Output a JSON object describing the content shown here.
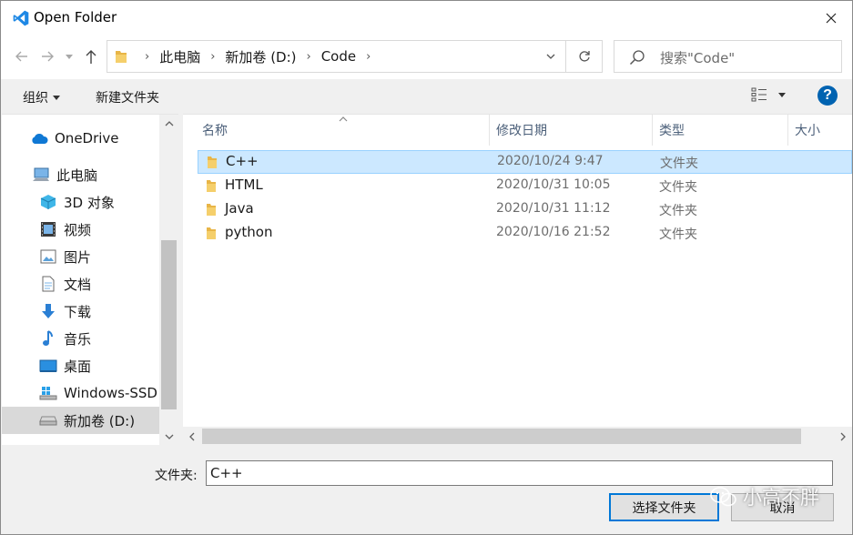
{
  "window": {
    "title": "Open Folder"
  },
  "nav": {
    "breadcrumbs": [
      "此电脑",
      "新加卷 (D:)",
      "Code"
    ],
    "search_placeholder": "搜索\"Code\""
  },
  "toolbar": {
    "organize": "组织",
    "new_folder": "新建文件夹",
    "help": "?"
  },
  "sidebar": {
    "items": [
      {
        "label": "OneDrive",
        "icon": "cloud-icon"
      },
      {
        "label": "此电脑",
        "icon": "computer-icon"
      },
      {
        "label": "3D 对象",
        "icon": "cube-3d-icon"
      },
      {
        "label": "视频",
        "icon": "video-icon"
      },
      {
        "label": "图片",
        "icon": "pictures-icon"
      },
      {
        "label": "文档",
        "icon": "documents-icon"
      },
      {
        "label": "下载",
        "icon": "download-icon"
      },
      {
        "label": "音乐",
        "icon": "music-icon"
      },
      {
        "label": "桌面",
        "icon": "desktop-icon"
      },
      {
        "label": "Windows-SSD",
        "icon": "windows-drive-icon"
      },
      {
        "label": "新加卷 (D:)",
        "icon": "drive-icon",
        "selected": true
      }
    ]
  },
  "file_list": {
    "columns": [
      "名称",
      "修改日期",
      "类型",
      "大小"
    ],
    "rows": [
      {
        "name": "C++",
        "modified": "2020/10/24 9:47",
        "type": "文件夹",
        "selected": true
      },
      {
        "name": "HTML",
        "modified": "2020/10/31 10:05",
        "type": "文件夹"
      },
      {
        "name": "Java",
        "modified": "2020/10/31 11:12",
        "type": "文件夹"
      },
      {
        "name": "python",
        "modified": "2020/10/16 21:52",
        "type": "文件夹"
      }
    ]
  },
  "footer": {
    "folder_label": "文件夹:",
    "folder_value": "C++",
    "select_button": "选择文件夹",
    "cancel_button": "取消"
  },
  "watermark": {
    "text": "小高不胖"
  },
  "colors": {
    "accent": "#0078d7",
    "selection": "#cce8ff",
    "folder": "#e8b547",
    "vscode_blue": "#1e88e5"
  }
}
